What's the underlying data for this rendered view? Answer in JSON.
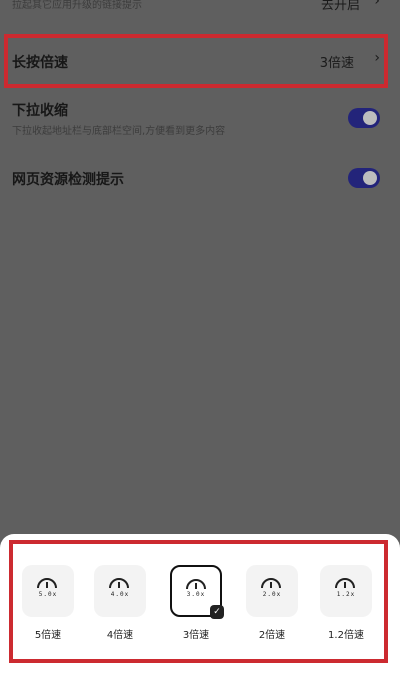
{
  "top_row": {
    "desc": "拉起其它应用升级的链接提示",
    "value": "去开启",
    "chevron": "›"
  },
  "long_press_speed": {
    "title": "长按倍速",
    "value": "3倍速",
    "chevron": "›"
  },
  "pull_down_collapse": {
    "title": "下拉收缩",
    "desc": "下拉收起地址栏与底部栏空间,方便看到更多内容",
    "toggle_on": true
  },
  "web_resource_detect": {
    "title": "网页资源检测提示",
    "toggle_on": true
  },
  "speed_options": [
    {
      "label": "5倍速",
      "gauge": "5.0x",
      "selected": false
    },
    {
      "label": "4倍速",
      "gauge": "4.0x",
      "selected": false
    },
    {
      "label": "3倍速",
      "gauge": "3.0x",
      "selected": true
    },
    {
      "label": "2倍速",
      "gauge": "2.0x",
      "selected": false
    },
    {
      "label": "1.2倍速",
      "gauge": "1.2x",
      "selected": false
    }
  ],
  "colors": {
    "overlay_bg": "#5f5f5f",
    "highlight": "#cc2a30",
    "toggle_on": "#23247a",
    "sheet_bg": "#ffffff"
  },
  "icons": {
    "gauge": "speedometer-icon",
    "check": "check-icon",
    "chevron": "chevron-right-icon"
  }
}
